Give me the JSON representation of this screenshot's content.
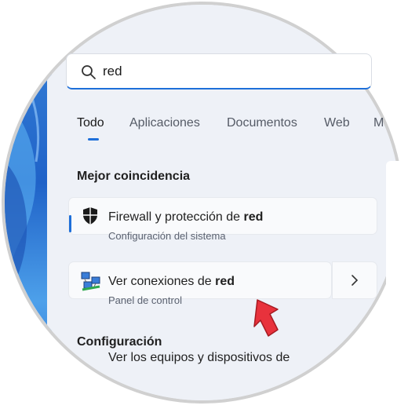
{
  "search": {
    "query": "red"
  },
  "tabs": [
    {
      "label": "Todo",
      "active": true
    },
    {
      "label": "Aplicaciones"
    },
    {
      "label": "Documentos"
    },
    {
      "label": "Web"
    },
    {
      "label": "M"
    }
  ],
  "best_match": {
    "heading": "Mejor coincidencia",
    "items": [
      {
        "title_prefix": "Firewall y protección de ",
        "title_bold": "red",
        "subtitle": "Configuración del sistema",
        "icon": "shield-icon"
      },
      {
        "title_prefix": "Ver conexiones de ",
        "title_bold": "red",
        "subtitle": "Panel de control",
        "icon": "network-connections-icon"
      }
    ]
  },
  "settings": {
    "heading": "Configuración",
    "items": [
      {
        "title": "Ver los equipos y dispositivos de"
      }
    ]
  },
  "colors": {
    "accent": "#1e6fd9",
    "cursor": "#e8323c"
  }
}
